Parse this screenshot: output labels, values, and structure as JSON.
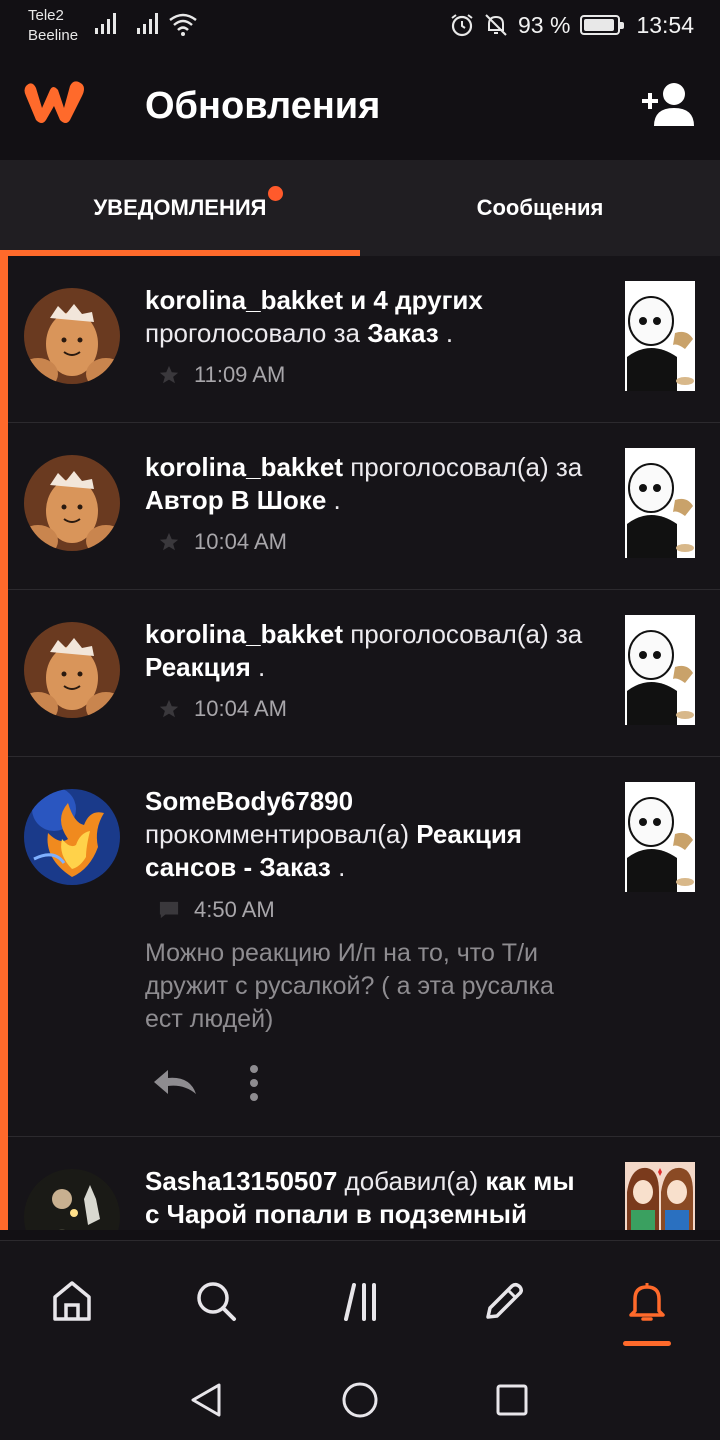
{
  "status_bar": {
    "carrier1": "Tele2",
    "carrier2": "Beeline",
    "battery": "93 %",
    "battery_level": 0.93,
    "time": "13:54"
  },
  "app_bar": {
    "title": "Обновления",
    "logo_icon": "wattpad-logo-icon",
    "add_user_icon": "add-user-icon"
  },
  "tabs": [
    {
      "label": "УВЕДОМЛЕНИЯ",
      "active": true,
      "has_badge": true
    },
    {
      "label": "Сообщения",
      "active": false
    }
  ],
  "notifications": [
    {
      "user": "korolina_bakket",
      "suffix": " и 4 других",
      "action": "проголосовало за ",
      "story": "Заказ",
      "end": " .",
      "time": "11:09 AM",
      "meta_icon": "star-icon"
    },
    {
      "user": "korolina_bakket",
      "action": " проголосовал(а) за ",
      "story": "Автор В Шоке",
      "end": " .",
      "time": "10:04 AM",
      "meta_icon": "star-icon"
    },
    {
      "user": "korolina_bakket",
      "action": " проголосовал(а) за ",
      "story": "Реакция",
      "end": " .",
      "time": "10:04 AM",
      "meta_icon": "star-icon"
    },
    {
      "user": "SomeBody67890",
      "action": " прокомментировал(а) ",
      "story": "Реакция сансов - Заказ",
      "end": " .",
      "time": "4:50 AM",
      "meta_icon": "comment-icon",
      "comment": "Можно реакцию И/п на то, что Т/и дружит с русалкой? ( а эта русалка ест людей)",
      "actions": [
        "reply-icon",
        "more-icon"
      ]
    },
    {
      "user": "Sasha13150507",
      "action": " добавил(а) ",
      "story": "как мы с Чарой попали в подземный"
    }
  ],
  "bottom_nav": [
    {
      "name": "home",
      "icon": "home-icon"
    },
    {
      "name": "search",
      "icon": "search-icon"
    },
    {
      "name": "library",
      "icon": "library-icon"
    },
    {
      "name": "write",
      "icon": "pencil-icon"
    },
    {
      "name": "notifications",
      "icon": "bell-icon",
      "active": true
    }
  ],
  "colors": {
    "accent": "#ff6a2b",
    "background": "#121014",
    "surface": "#201e22"
  }
}
